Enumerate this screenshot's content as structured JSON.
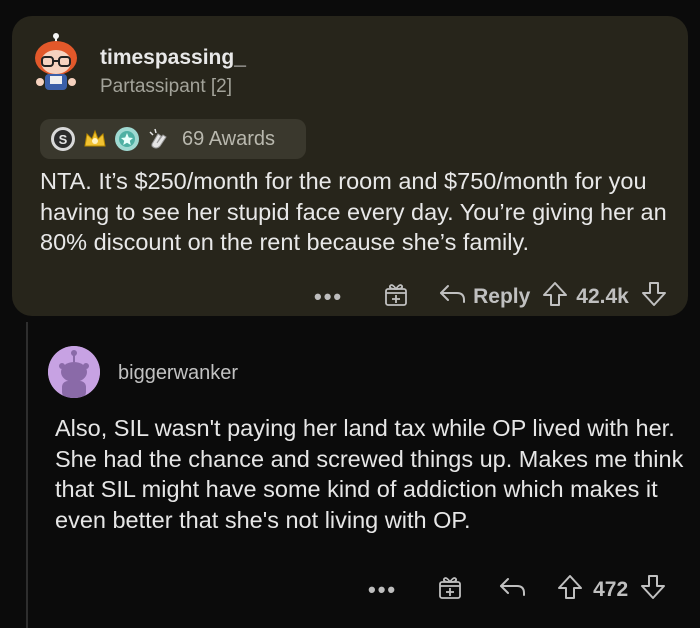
{
  "top_comment": {
    "username": "timespassing_",
    "flair": "Partassipant [2]",
    "awards_label": "69 Awards",
    "award_icons": [
      "silver-award-icon",
      "gold-crown-award-icon",
      "platinum-award-icon",
      "clapping-hands-award-icon"
    ],
    "text": "NTA. It’s $250/month for the room and $750/month for you having to see her stupid face every day. You’re giving her an 80% discount on the rent because she’s family.",
    "actions": {
      "more": "•••",
      "reply": "Reply",
      "votes": "42.4k"
    }
  },
  "reply_comment": {
    "username": "biggerwanker",
    "text": "Also, SIL wasn't paying her land tax while OP lived with her. She had the chance and screwed things up. Makes me think that SIL might have some kind of addiction which makes it even better that she's not living with OP.",
    "actions": {
      "more": "•••",
      "votes": "472"
    }
  },
  "colors": {
    "background": "#0b0b0b",
    "highlight_card": "#27251b",
    "awards_bg": "#3a382d",
    "avatar2_bg": "#c7a2e3"
  }
}
